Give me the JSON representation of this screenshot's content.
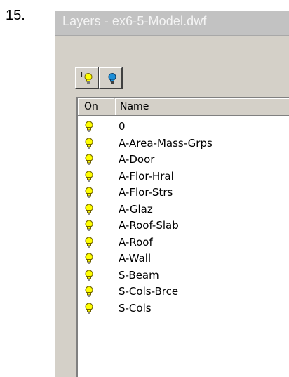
{
  "step_number": "15.",
  "window": {
    "title": "Layers - ex6-5-Model.dwf"
  },
  "toolbar": {
    "add_sign": "+",
    "remove_sign": "−",
    "add_icon": "lightbulb-on-icon",
    "remove_icon": "lightbulb-off-icon"
  },
  "list": {
    "columns": {
      "on": "On",
      "name": "Name"
    },
    "rows": [
      {
        "name": "0",
        "on": true
      },
      {
        "name": "A-Area-Mass-Grps",
        "on": true
      },
      {
        "name": "A-Door",
        "on": true
      },
      {
        "name": "A-Flor-Hral",
        "on": true
      },
      {
        "name": "A-Flor-Strs",
        "on": true
      },
      {
        "name": "A-Glaz",
        "on": true
      },
      {
        "name": "A-Roof-Slab",
        "on": true
      },
      {
        "name": "A-Roof",
        "on": true
      },
      {
        "name": "A-Wall",
        "on": true
      },
      {
        "name": "S-Beam",
        "on": true
      },
      {
        "name": "S-Cols-Brce",
        "on": true
      },
      {
        "name": "S-Cols",
        "on": true
      }
    ]
  },
  "colors": {
    "bulb_on": "#ffff00",
    "bulb_off": "#1e8fd8",
    "window_face": "#d4d0c8",
    "title_bar": "#c2c2c2"
  }
}
